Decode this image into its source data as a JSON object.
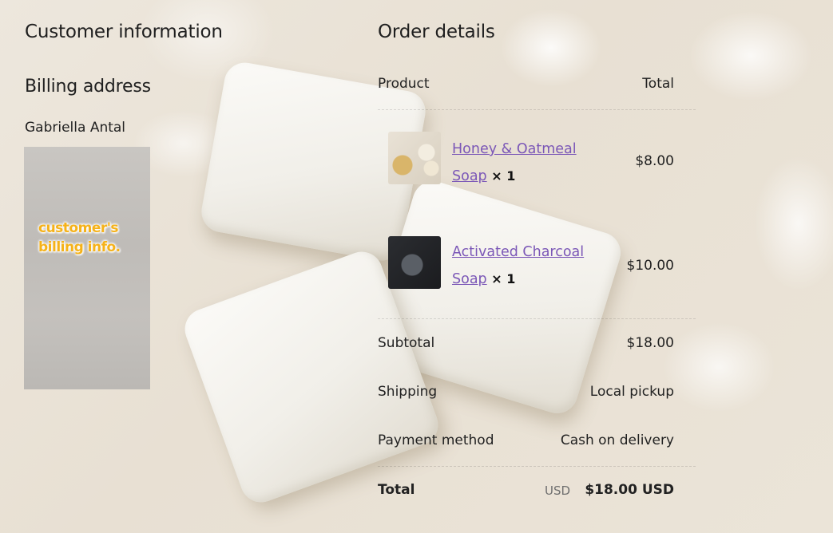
{
  "customer": {
    "heading": "Customer information",
    "billing_heading": "Billing address",
    "name": "Gabriella Antal",
    "redacted_note": "customer's\nbilling info."
  },
  "order": {
    "heading": "Order details",
    "col_product": "Product",
    "col_total": "Total",
    "items": [
      {
        "name_line1": "Honey & Oatmeal",
        "name_line2": "Soap",
        "qty": "× 1",
        "total": "$8.00",
        "thumb_icon": "honey-oatmeal-soap-thumbnail"
      },
      {
        "name_line1": "Activated Charcoal",
        "name_line2": "Soap",
        "qty": "× 1",
        "total": "$10.00",
        "thumb_icon": "activated-charcoal-soap-thumbnail"
      }
    ],
    "subtotal_label": "Subtotal",
    "subtotal_value": "$18.00",
    "shipping_label": "Shipping",
    "shipping_value": "Local pickup",
    "payment_label": "Payment method",
    "payment_value": "Cash on delivery",
    "total_label": "Total",
    "total_currency": "USD",
    "total_value": "$18.00 USD"
  },
  "colors": {
    "link": "#7b57b7",
    "annotation": "#f5b21a"
  }
}
